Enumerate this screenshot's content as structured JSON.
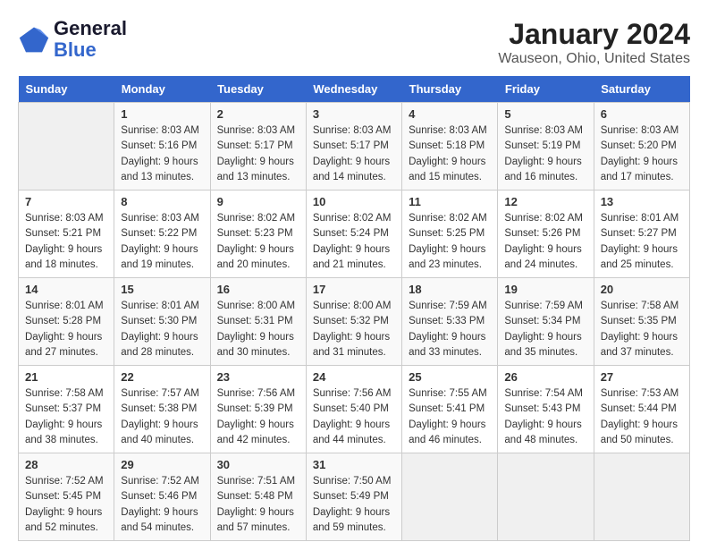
{
  "header": {
    "logo_line1": "General",
    "logo_line2": "Blue",
    "title": "January 2024",
    "subtitle": "Wauseon, Ohio, United States"
  },
  "days_of_week": [
    "Sunday",
    "Monday",
    "Tuesday",
    "Wednesday",
    "Thursday",
    "Friday",
    "Saturday"
  ],
  "weeks": [
    [
      {
        "day": "",
        "sunrise": "",
        "sunset": "",
        "daylight": "",
        "empty": true
      },
      {
        "day": "1",
        "sunrise": "Sunrise: 8:03 AM",
        "sunset": "Sunset: 5:16 PM",
        "daylight": "Daylight: 9 hours and 13 minutes."
      },
      {
        "day": "2",
        "sunrise": "Sunrise: 8:03 AM",
        "sunset": "Sunset: 5:17 PM",
        "daylight": "Daylight: 9 hours and 13 minutes."
      },
      {
        "day": "3",
        "sunrise": "Sunrise: 8:03 AM",
        "sunset": "Sunset: 5:17 PM",
        "daylight": "Daylight: 9 hours and 14 minutes."
      },
      {
        "day": "4",
        "sunrise": "Sunrise: 8:03 AM",
        "sunset": "Sunset: 5:18 PM",
        "daylight": "Daylight: 9 hours and 15 minutes."
      },
      {
        "day": "5",
        "sunrise": "Sunrise: 8:03 AM",
        "sunset": "Sunset: 5:19 PM",
        "daylight": "Daylight: 9 hours and 16 minutes."
      },
      {
        "day": "6",
        "sunrise": "Sunrise: 8:03 AM",
        "sunset": "Sunset: 5:20 PM",
        "daylight": "Daylight: 9 hours and 17 minutes."
      }
    ],
    [
      {
        "day": "7",
        "sunrise": "Sunrise: 8:03 AM",
        "sunset": "Sunset: 5:21 PM",
        "daylight": "Daylight: 9 hours and 18 minutes."
      },
      {
        "day": "8",
        "sunrise": "Sunrise: 8:03 AM",
        "sunset": "Sunset: 5:22 PM",
        "daylight": "Daylight: 9 hours and 19 minutes."
      },
      {
        "day": "9",
        "sunrise": "Sunrise: 8:02 AM",
        "sunset": "Sunset: 5:23 PM",
        "daylight": "Daylight: 9 hours and 20 minutes."
      },
      {
        "day": "10",
        "sunrise": "Sunrise: 8:02 AM",
        "sunset": "Sunset: 5:24 PM",
        "daylight": "Daylight: 9 hours and 21 minutes."
      },
      {
        "day": "11",
        "sunrise": "Sunrise: 8:02 AM",
        "sunset": "Sunset: 5:25 PM",
        "daylight": "Daylight: 9 hours and 23 minutes."
      },
      {
        "day": "12",
        "sunrise": "Sunrise: 8:02 AM",
        "sunset": "Sunset: 5:26 PM",
        "daylight": "Daylight: 9 hours and 24 minutes."
      },
      {
        "day": "13",
        "sunrise": "Sunrise: 8:01 AM",
        "sunset": "Sunset: 5:27 PM",
        "daylight": "Daylight: 9 hours and 25 minutes."
      }
    ],
    [
      {
        "day": "14",
        "sunrise": "Sunrise: 8:01 AM",
        "sunset": "Sunset: 5:28 PM",
        "daylight": "Daylight: 9 hours and 27 minutes."
      },
      {
        "day": "15",
        "sunrise": "Sunrise: 8:01 AM",
        "sunset": "Sunset: 5:30 PM",
        "daylight": "Daylight: 9 hours and 28 minutes."
      },
      {
        "day": "16",
        "sunrise": "Sunrise: 8:00 AM",
        "sunset": "Sunset: 5:31 PM",
        "daylight": "Daylight: 9 hours and 30 minutes."
      },
      {
        "day": "17",
        "sunrise": "Sunrise: 8:00 AM",
        "sunset": "Sunset: 5:32 PM",
        "daylight": "Daylight: 9 hours and 31 minutes."
      },
      {
        "day": "18",
        "sunrise": "Sunrise: 7:59 AM",
        "sunset": "Sunset: 5:33 PM",
        "daylight": "Daylight: 9 hours and 33 minutes."
      },
      {
        "day": "19",
        "sunrise": "Sunrise: 7:59 AM",
        "sunset": "Sunset: 5:34 PM",
        "daylight": "Daylight: 9 hours and 35 minutes."
      },
      {
        "day": "20",
        "sunrise": "Sunrise: 7:58 AM",
        "sunset": "Sunset: 5:35 PM",
        "daylight": "Daylight: 9 hours and 37 minutes."
      }
    ],
    [
      {
        "day": "21",
        "sunrise": "Sunrise: 7:58 AM",
        "sunset": "Sunset: 5:37 PM",
        "daylight": "Daylight: 9 hours and 38 minutes."
      },
      {
        "day": "22",
        "sunrise": "Sunrise: 7:57 AM",
        "sunset": "Sunset: 5:38 PM",
        "daylight": "Daylight: 9 hours and 40 minutes."
      },
      {
        "day": "23",
        "sunrise": "Sunrise: 7:56 AM",
        "sunset": "Sunset: 5:39 PM",
        "daylight": "Daylight: 9 hours and 42 minutes."
      },
      {
        "day": "24",
        "sunrise": "Sunrise: 7:56 AM",
        "sunset": "Sunset: 5:40 PM",
        "daylight": "Daylight: 9 hours and 44 minutes."
      },
      {
        "day": "25",
        "sunrise": "Sunrise: 7:55 AM",
        "sunset": "Sunset: 5:41 PM",
        "daylight": "Daylight: 9 hours and 46 minutes."
      },
      {
        "day": "26",
        "sunrise": "Sunrise: 7:54 AM",
        "sunset": "Sunset: 5:43 PM",
        "daylight": "Daylight: 9 hours and 48 minutes."
      },
      {
        "day": "27",
        "sunrise": "Sunrise: 7:53 AM",
        "sunset": "Sunset: 5:44 PM",
        "daylight": "Daylight: 9 hours and 50 minutes."
      }
    ],
    [
      {
        "day": "28",
        "sunrise": "Sunrise: 7:52 AM",
        "sunset": "Sunset: 5:45 PM",
        "daylight": "Daylight: 9 hours and 52 minutes."
      },
      {
        "day": "29",
        "sunrise": "Sunrise: 7:52 AM",
        "sunset": "Sunset: 5:46 PM",
        "daylight": "Daylight: 9 hours and 54 minutes."
      },
      {
        "day": "30",
        "sunrise": "Sunrise: 7:51 AM",
        "sunset": "Sunset: 5:48 PM",
        "daylight": "Daylight: 9 hours and 57 minutes."
      },
      {
        "day": "31",
        "sunrise": "Sunrise: 7:50 AM",
        "sunset": "Sunset: 5:49 PM",
        "daylight": "Daylight: 9 hours and 59 minutes."
      },
      {
        "day": "",
        "sunrise": "",
        "sunset": "",
        "daylight": "",
        "empty": true
      },
      {
        "day": "",
        "sunrise": "",
        "sunset": "",
        "daylight": "",
        "empty": true
      },
      {
        "day": "",
        "sunrise": "",
        "sunset": "",
        "daylight": "",
        "empty": true
      }
    ]
  ]
}
